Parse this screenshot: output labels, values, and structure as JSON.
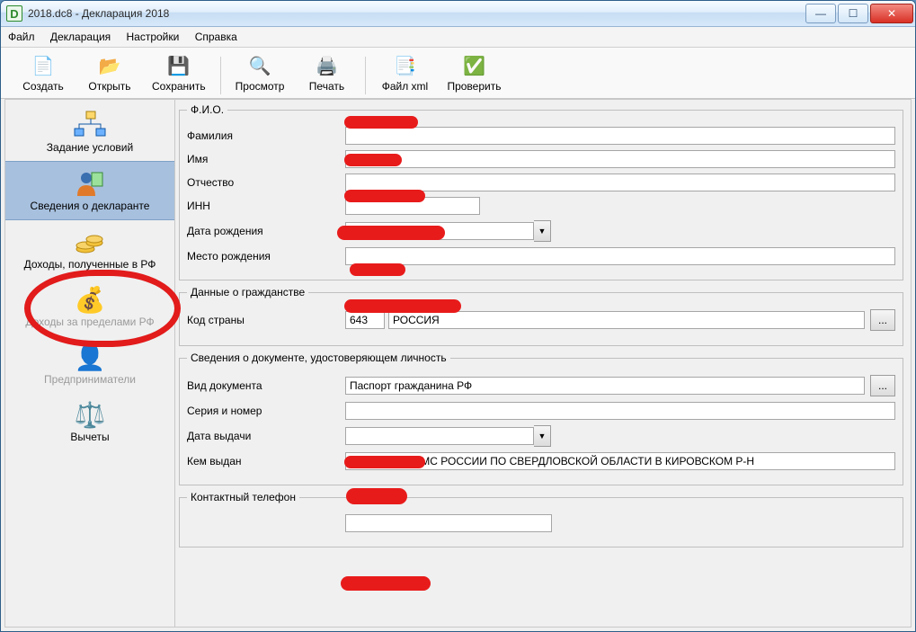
{
  "window": {
    "title": "2018.dc8 - Декларация 2018"
  },
  "menu": {
    "file": "Файл",
    "decl": "Декларация",
    "settings": "Настройки",
    "help": "Справка"
  },
  "toolbar": {
    "create": "Создать",
    "open": "Открыть",
    "save": "Сохранить",
    "preview": "Просмотр",
    "print": "Печать",
    "xml": "Файл xml",
    "check": "Проверить"
  },
  "sidebar": {
    "conditions": "Задание условий",
    "declarant": "Сведения о декларанте",
    "income_rf": "Доходы, полученные в РФ",
    "income_abroad": "Доходы за пределами РФ",
    "entrepreneurs": "Предприниматели",
    "deductions": "Вычеты"
  },
  "fio": {
    "legend": "Ф.И.О.",
    "surname": "Фамилия",
    "surname_val": "",
    "name": "Имя",
    "name_val": "",
    "patronymic": "Отчество",
    "patronymic_val": "",
    "inn": "ИНН",
    "inn_val": "",
    "dob": "Дата рождения",
    "dob_val": "",
    "pob": "Место рождения",
    "pob_val": ""
  },
  "citizenship": {
    "legend": "Данные о гражданстве",
    "code_label": "Код страны",
    "code": "643",
    "country": "РОССИЯ"
  },
  "document": {
    "legend": "Сведения о документе, удостоверяющем личность",
    "type_label": "Вид документа",
    "type": "Паспорт гражданина РФ",
    "serial_label": "Серия и номер",
    "serial": "",
    "issue_date_label": "Дата выдачи",
    "issue_date": "",
    "issued_by_label": "Кем выдан",
    "issued_by": "ОТДЕЛОМ УФМС РОССИИ ПО СВЕРДЛОВСКОЙ ОБЛАСТИ В КИРОВСКОМ Р-Н"
  },
  "phone": {
    "legend": "Контактный телефон",
    "val": ""
  },
  "browse": "..."
}
